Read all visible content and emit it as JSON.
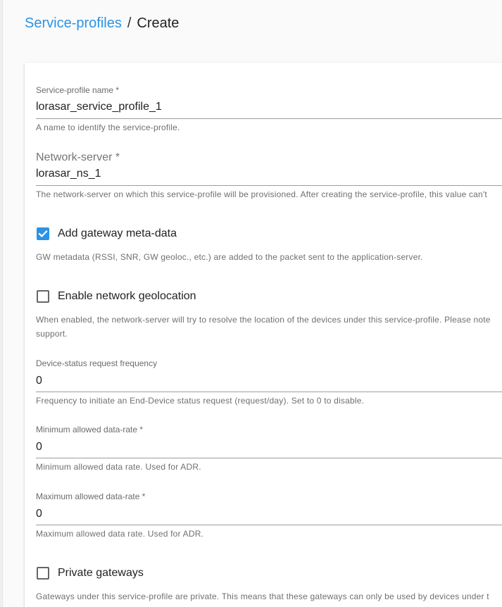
{
  "breadcrumb": {
    "parent": "Service-profiles",
    "separator": "/",
    "current": "Create"
  },
  "form": {
    "profile_name": {
      "label": "Service-profile name *",
      "value": "lorasar_service_profile_1",
      "helper": "A name to identify the service-profile."
    },
    "network_server": {
      "label": "Network-server *",
      "value": "lorasar_ns_1",
      "helper": "The network-server on which this service-profile will be provisioned. After creating the service-profile, this value can't"
    },
    "add_gw_metadata": {
      "label": "Add gateway meta-data",
      "checked": true,
      "helper": "GW metadata (RSSI, SNR, GW geoloc., etc.) are added to the packet sent to the application-server."
    },
    "network_geolocation": {
      "label": "Enable network geolocation",
      "checked": false,
      "helper_line1": "When enabled, the network-server will try to resolve the location of the devices under this service-profile. Please note",
      "helper_line2": "support."
    },
    "dev_status_freq": {
      "label": "Device-status request frequency",
      "value": "0",
      "helper": "Frequency to initiate an End-Device status request (request/day). Set to 0 to disable."
    },
    "min_dr": {
      "label": "Minimum allowed data-rate *",
      "value": "0",
      "helper": "Minimum allowed data rate. Used for ADR."
    },
    "max_dr": {
      "label": "Maximum allowed data-rate *",
      "value": "0",
      "helper": "Maximum allowed data rate. Used for ADR."
    },
    "private_gateways": {
      "label": "Private gateways",
      "checked": false,
      "helper": "Gateways under this service-profile are private. This means that these gateways can only be used by devices under t"
    }
  },
  "colors": {
    "accent": "#2b93e6",
    "text": "#222222",
    "helper": "#6f6f6f"
  }
}
